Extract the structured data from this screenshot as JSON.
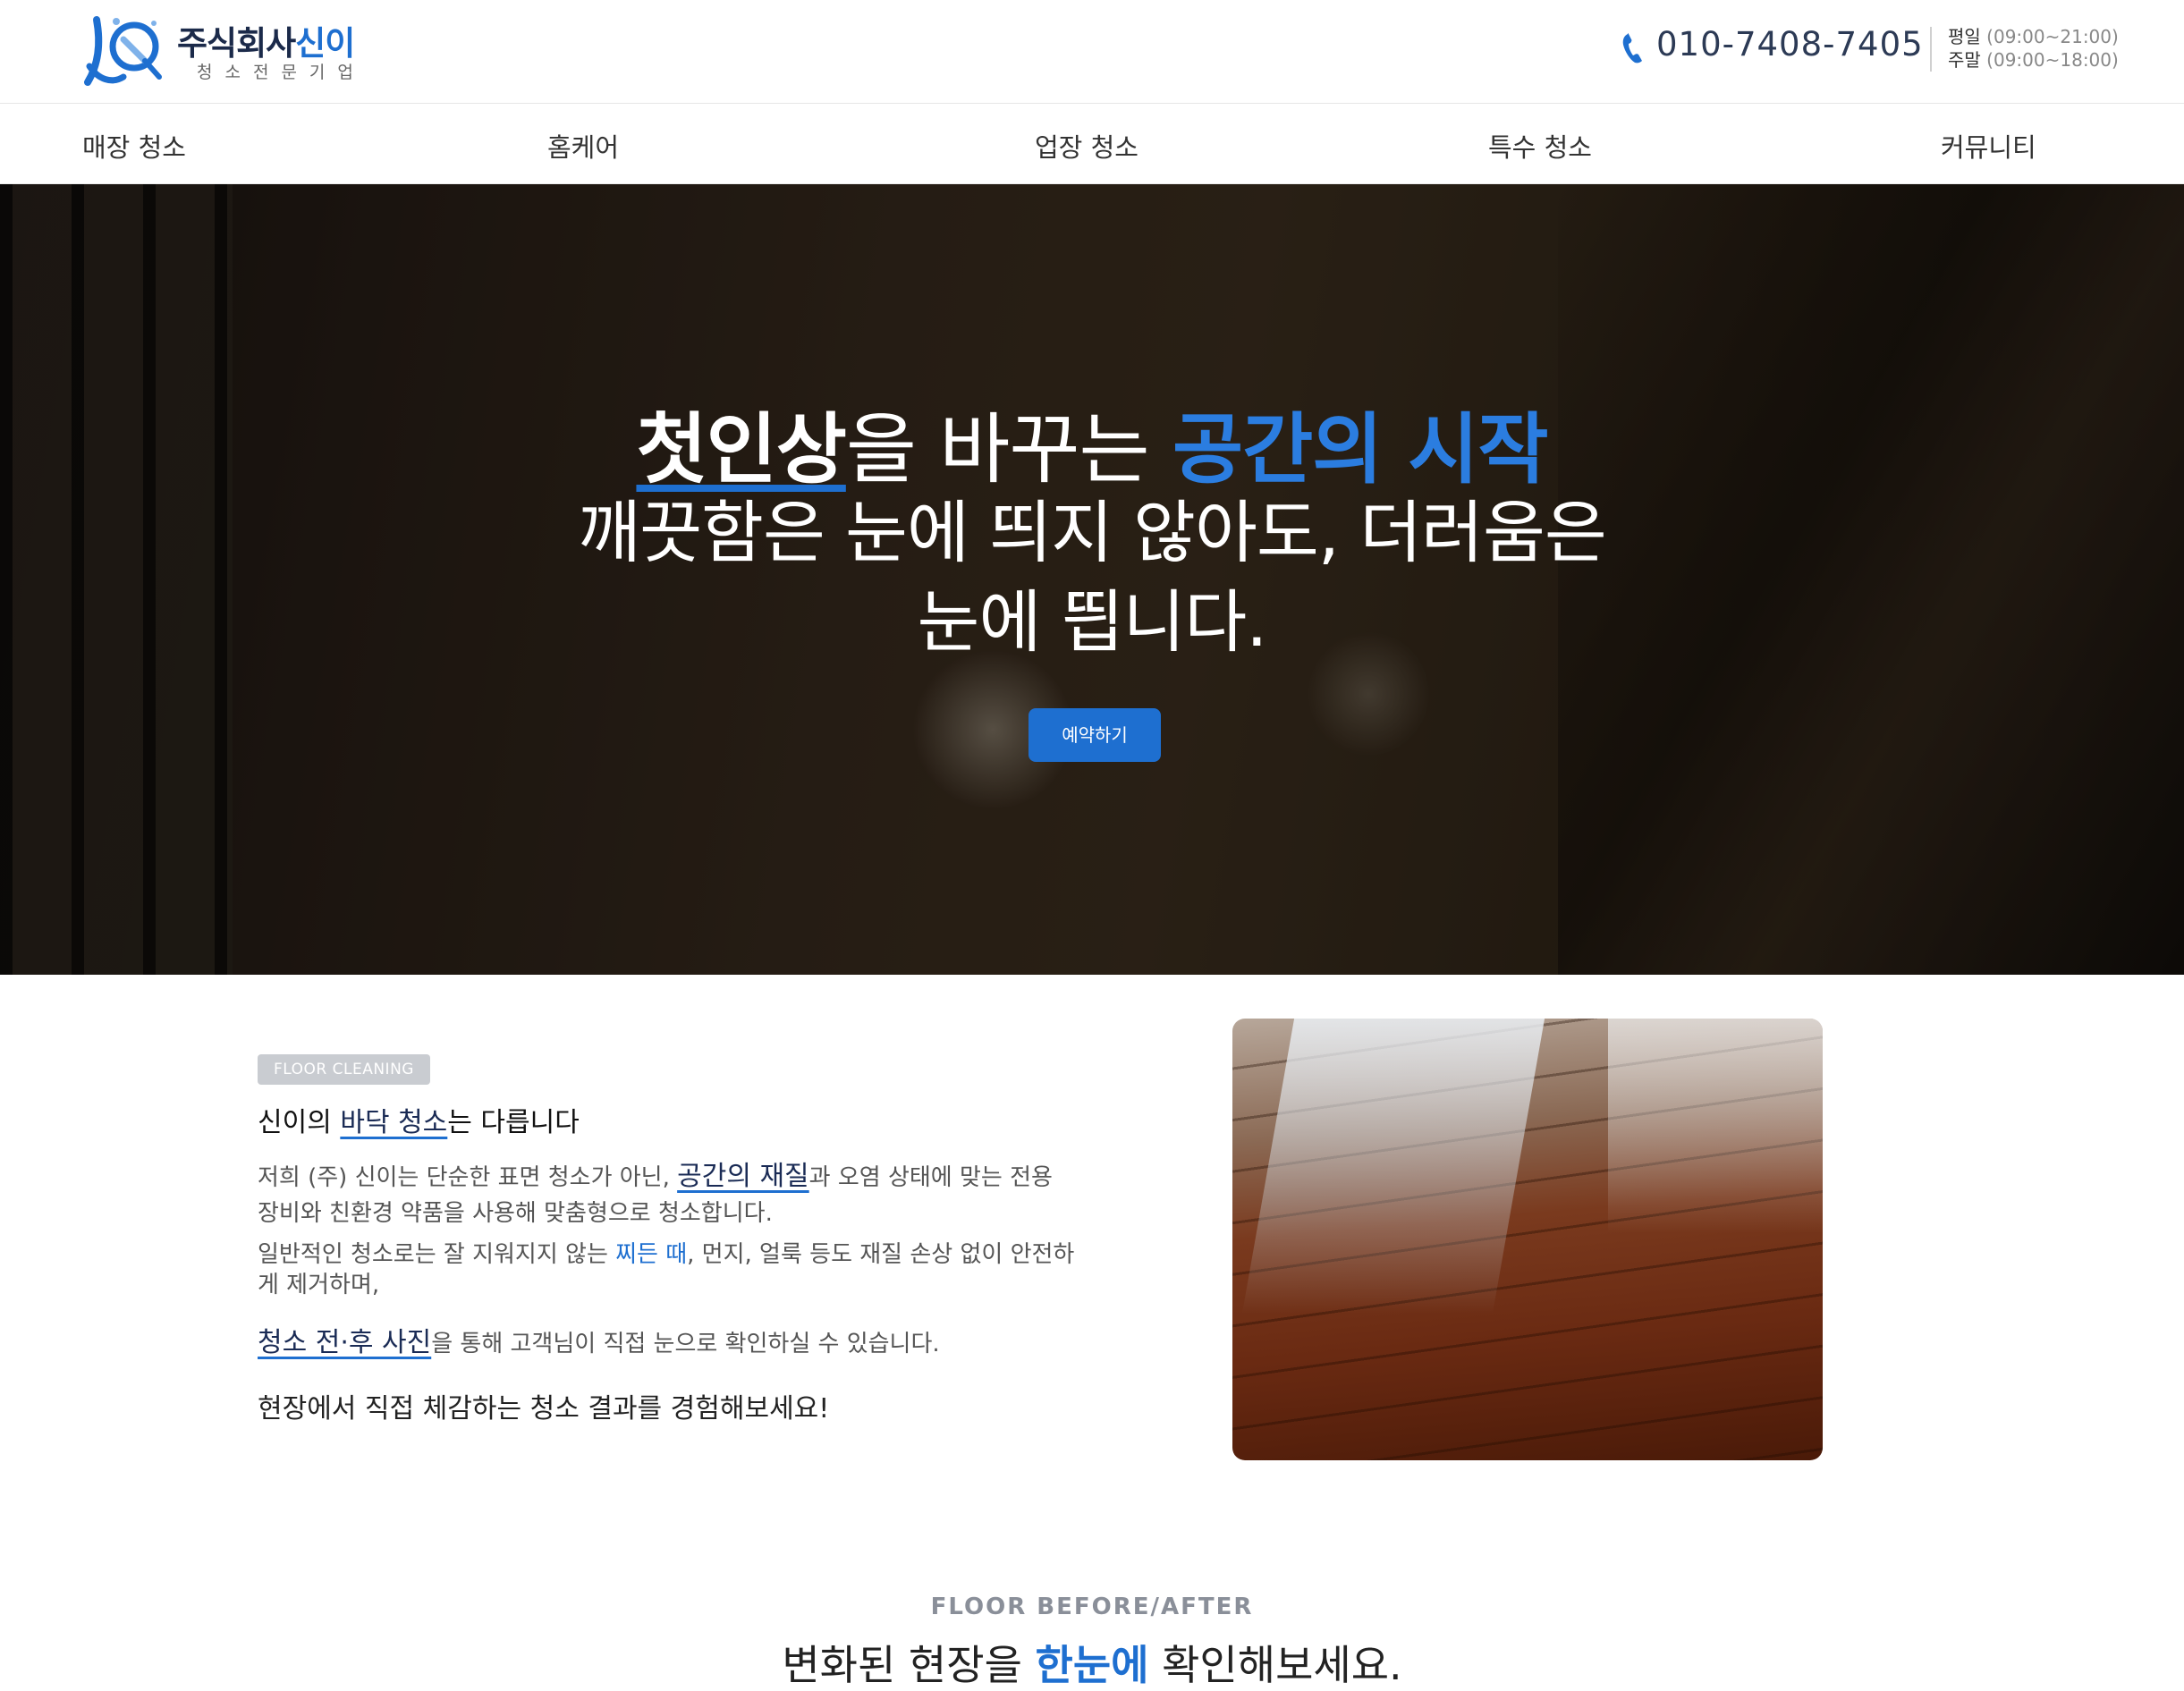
{
  "header": {
    "logo_title_main": "주식회사",
    "logo_title_accent": "신이",
    "logo_subtitle": "청소전문기업",
    "phone": "010-7408-7405",
    "hours_weekday_label": "평일",
    "hours_weekday_time": "(09:00~21:00)",
    "hours_weekend_label": "주말",
    "hours_weekend_time": "(09:00~18:00)"
  },
  "nav": {
    "items": [
      "매장 청소",
      "홈케어",
      "업장 청소",
      "특수 청소",
      "커뮤니티"
    ]
  },
  "hero": {
    "line1_strong": "첫인상",
    "line1_mid": "을 바꾸는 ",
    "line1_blue": "공간의 시작",
    "line2": "깨끗함은 눈에 띄지 않아도, 더러움은",
    "line3": "눈에 띕니다.",
    "button": "예약하기"
  },
  "floor": {
    "badge": "FLOOR CLEANING",
    "title_pre": "신이의 ",
    "title_underline": "바닥 청소",
    "title_post": "는 다릅니다",
    "p1_a": "저희 (주) 신이는 단순한 표면 청소가 아닌, ",
    "p1_link": "공간의 재질",
    "p1_b": "과 오염 상태에 맞는 전용 장비와 친환경 약품을 사용해 맞춤형으로 청소합니다.",
    "p2_a": "일반적인 청소로는 잘 지워지지 않는 ",
    "p2_blue": "찌든 때",
    "p2_b": ", 먼지, 얼룩 등도 재질 손상 없이 안전하게 제거하며,",
    "p3_link": "청소 전·후 사진",
    "p3_b": "을 통해 고객님이 직접 눈으로 확인하실 수 있습니다.",
    "final": "현장에서 직접 체감하는 청소 결과를 경험해보세요!"
  },
  "before_after": {
    "label": "FLOOR BEFORE/AFTER",
    "title_pre": "변화된 현장을 ",
    "title_blue": "한눈에",
    "title_post": " 확인해보세요."
  },
  "colors": {
    "accent": "#1e6fd0",
    "navy": "#1a2b55"
  }
}
